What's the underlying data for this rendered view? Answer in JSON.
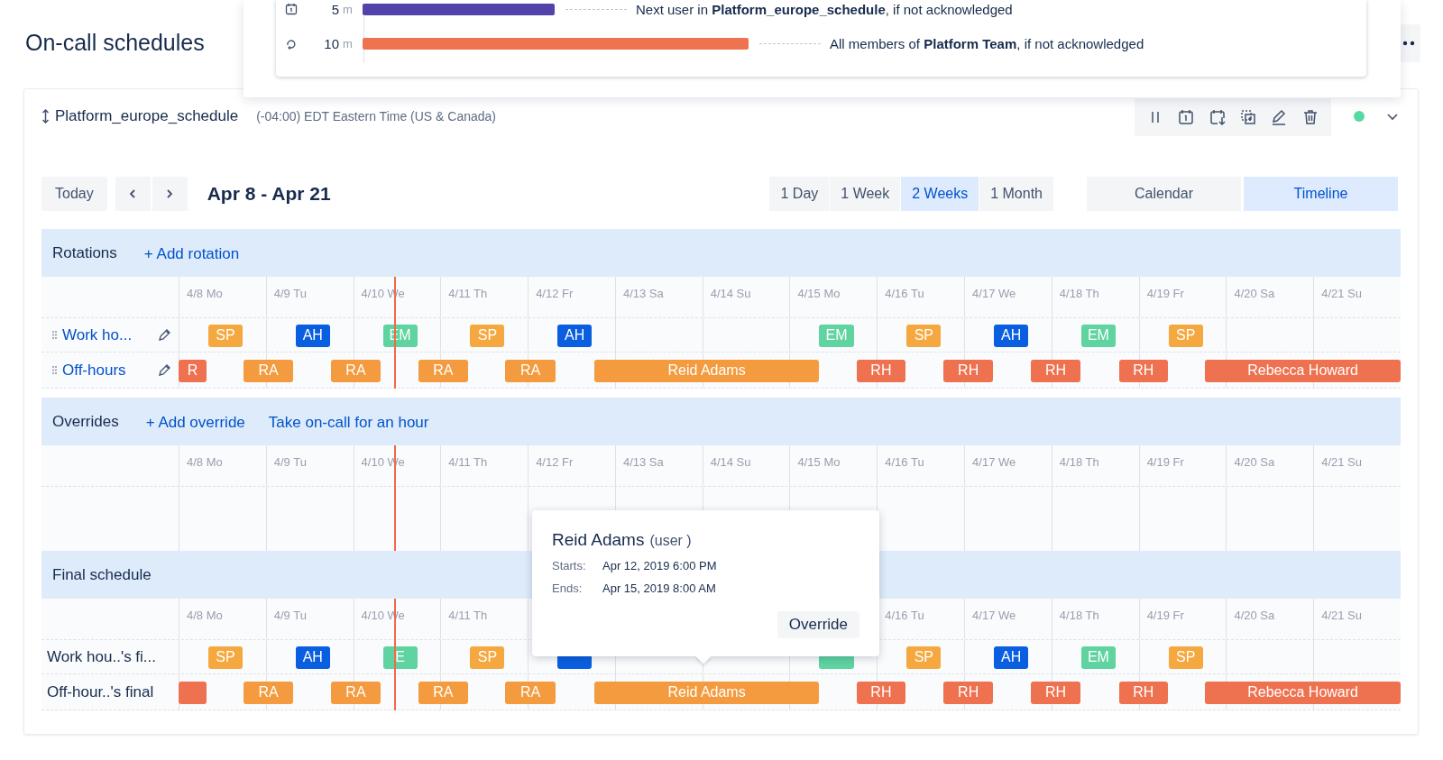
{
  "page_title": "On-call schedules",
  "escalation_popover": {
    "steps": [
      {
        "kind": "timer",
        "delay": "5",
        "unit": "m",
        "color": "#5243aa",
        "text": "Next user in **Platform_europe_schedule**, if not acknowledged"
      },
      {
        "kind": "repeat",
        "delay": "10",
        "unit": "m",
        "color": "#f07350",
        "text": "All members of **Platform Team**, if not acknowledged"
      }
    ]
  },
  "schedule": {
    "name": "Platform_europe_schedule",
    "timezone": "(-04:00) EDT Eastern Time (US & Canada)",
    "enabled": true
  },
  "controls": {
    "today": "Today",
    "range": "Apr 8 - Apr 21",
    "periods": [
      {
        "label": "1 Day",
        "selected": false
      },
      {
        "label": "1 Week",
        "selected": false
      },
      {
        "label": "2 Weeks",
        "selected": true
      },
      {
        "label": "1 Month",
        "selected": false
      }
    ],
    "views": [
      {
        "label": "Calendar",
        "selected": false
      },
      {
        "label": "Timeline",
        "selected": true
      }
    ]
  },
  "sections": [
    {
      "kind": "rotations",
      "title": "Rotations",
      "actions": [
        "+ Add rotation"
      ],
      "days": [
        "4/8 Mo",
        "4/9 Tu",
        "4/10 We",
        "4/11 Th",
        "4/12 Fr",
        "4/13 Sa",
        "4/14 Su",
        "4/15 Mo",
        "4/16 Tu",
        "4/17 We",
        "4/18 Th",
        "4/19 Fr",
        "4/20 Sa",
        "4/21 Su"
      ],
      "rows": [
        {
          "kind": "work",
          "label": "Work ho...",
          "bars": [
            {
              "label": "SP",
              "color": "#f5a83f"
            },
            {
              "label": "AH",
              "color": "#0a5fe0"
            },
            {
              "label": "EM",
              "color": "#5fd3a0"
            },
            {
              "label": "SP",
              "color": "#f5a83f"
            },
            {
              "label": "AH",
              "color": "#0a5fe0"
            },
            {
              "label": "EM",
              "color": "#5fd3a0"
            },
            {
              "label": "SP",
              "color": "#f5a83f"
            },
            {
              "label": "AH",
              "color": "#0a5fe0"
            },
            {
              "label": "EM",
              "color": "#5fd3a0"
            },
            {
              "label": "SP",
              "color": "#f5a83f"
            }
          ]
        },
        {
          "kind": "off-hours",
          "label": "Off-hours",
          "bars": [
            {
              "label": "R",
              "color": "#ee7150"
            },
            {
              "label": "RA",
              "color": "#f39b3e"
            },
            {
              "label": "RA",
              "color": "#f39b3e"
            },
            {
              "label": "RA",
              "color": "#f39b3e"
            },
            {
              "label": "RA",
              "color": "#f39b3e"
            },
            {
              "label": "Reid Adams",
              "color": "#f39b3e"
            },
            {
              "label": "RH",
              "color": "#ee7150"
            },
            {
              "label": "RH",
              "color": "#ee7150"
            },
            {
              "label": "RH",
              "color": "#ee7150"
            },
            {
              "label": "RH",
              "color": "#ee7150"
            },
            {
              "label": "Rebecca Howard",
              "color": "#ee7150"
            }
          ]
        }
      ]
    },
    {
      "kind": "overrides",
      "title": "Overrides",
      "actions": [
        "+ Add override",
        "Take on-call for an hour"
      ],
      "days": [
        "4/8 Mo",
        "4/9 Tu",
        "4/10 We",
        "4/11 Th",
        "4/12 Fr",
        "4/13 Sa",
        "4/14 Su",
        "4/15 Mo",
        "4/16 Tu",
        "4/17 We",
        "4/18 Th",
        "4/19 Fr",
        "4/20 Sa",
        "4/21 Su"
      ]
    },
    {
      "kind": "final",
      "title": "Final schedule",
      "days": [
        "4/8 Mo",
        "4/9 Tu",
        "4/10 We",
        "4/11 Th",
        "4/16 Tu",
        "4/17 We",
        "4/18 Th",
        "4/19 Fr",
        "4/20 Sa",
        "4/21 Su"
      ],
      "rows": [
        {
          "kind": "work",
          "label": "Work hou..'s fi...",
          "bars": [
            {
              "label": "SP",
              "color": "#f5a83f"
            },
            {
              "label": "AH",
              "color": "#0a5fe0"
            },
            {
              "label": "E",
              "color": "#5fd3a0"
            },
            {
              "label": "SP",
              "color": "#f5a83f"
            },
            {
              "color": "#0a5fe0"
            },
            {
              "color": "#5fd3a0"
            },
            {
              "label": "SP",
              "color": "#f5a83f"
            },
            {
              "label": "AH",
              "color": "#0a5fe0"
            },
            {
              "label": "EM",
              "color": "#5fd3a0"
            },
            {
              "label": "SP",
              "color": "#f5a83f"
            }
          ]
        },
        {
          "kind": "off-hours",
          "label": "Off-hour..'s final",
          "bars": [
            {
              "color": "#ee7150"
            },
            {
              "label": "RA",
              "color": "#f39b3e"
            },
            {
              "label": "RA",
              "color": "#f39b3e"
            },
            {
              "label": "RA",
              "color": "#f39b3e"
            },
            {
              "label": "RA",
              "color": "#f39b3e"
            },
            {
              "label": "Reid Adams",
              "color": "#f39b3e"
            },
            {
              "label": "RH",
              "color": "#ee7150"
            },
            {
              "label": "RH",
              "color": "#ee7150"
            },
            {
              "label": "RH",
              "color": "#ee7150"
            },
            {
              "label": "RH",
              "color": "#ee7150"
            },
            {
              "label": "Rebecca Howard",
              "color": "#ee7150"
            }
          ]
        }
      ]
    }
  ],
  "tooltip": {
    "name": "Reid Adams",
    "role": "(user )",
    "fields": [
      {
        "label": "Starts:",
        "value": "Apr 12, 2019 6:00 PM"
      },
      {
        "label": "Ends:",
        "value": "Apr 15, 2019 8:00 AM"
      }
    ],
    "button": "Override"
  }
}
